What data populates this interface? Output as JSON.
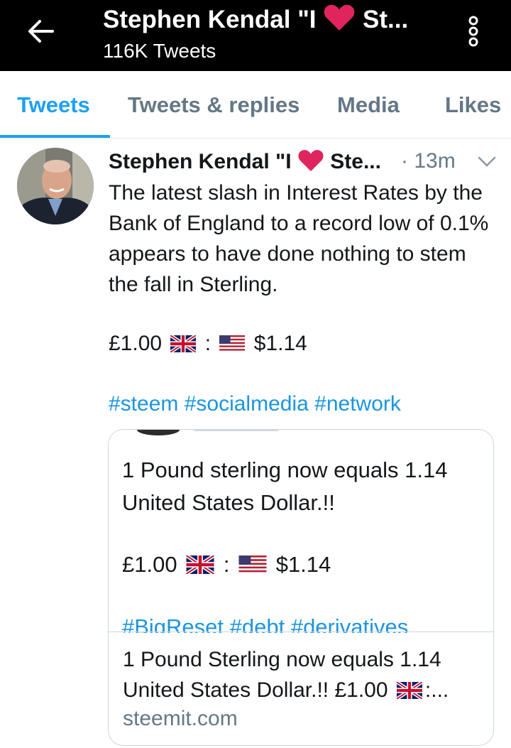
{
  "header": {
    "title_pre": "Stephen Kendal \"I",
    "title_post": "St...",
    "subtitle": "116K Tweets",
    "heart_color": "#e0245e",
    "icons": [
      "back-arrow-icon",
      "more-vertical-icon"
    ]
  },
  "tabs": [
    {
      "label": "Tweets",
      "active": true
    },
    {
      "label": "Tweets & replies"
    },
    {
      "label": "Media"
    },
    {
      "label": "Likes"
    }
  ],
  "tweet": {
    "author_pre": "Stephen Kendal \"I",
    "author_post": "Ste...",
    "time": "· 13m",
    "text": "The latest slash in Interest Rates by the Bank of England to a record low of 0.1% appears to have done nothing to stem the fall in Sterling.",
    "rate_left": "£1.00",
    "rate_sep": ":",
    "rate_right": "$1.14",
    "hashtags": "#steem #socialmedia #network",
    "card": {
      "text": "1 Pound sterling now equals 1.14 United States Dollar.!!",
      "rate_left": "£1.00",
      "rate_sep": ":",
      "rate_right": "$1.14",
      "hashtags_partial": "#BigReset #debt #derivatives",
      "link_line1": "1 Pound Sterling now equals 1.14",
      "link_line2_pre": "United States Dollar.!! £1.00",
      "link_line2_post": ":...",
      "domain": "steemit.com"
    }
  },
  "colors": {
    "accent": "#1da1f2",
    "link": "#1b95e0",
    "muted": "#657786",
    "header_bg": "#000000"
  }
}
